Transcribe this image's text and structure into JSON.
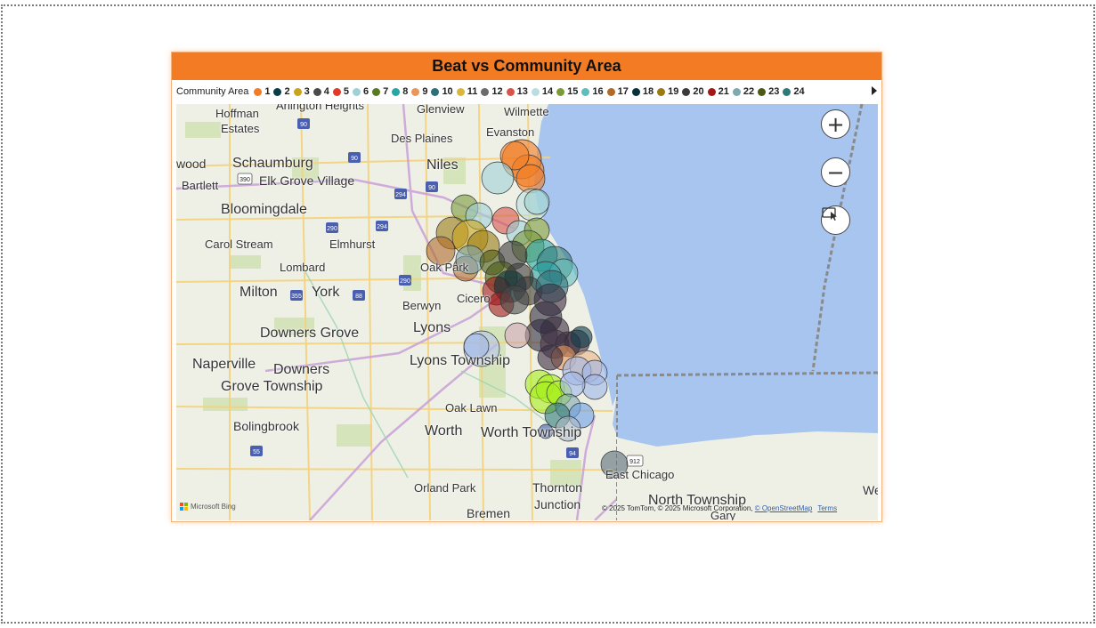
{
  "visual": {
    "title": "Beat vs Community Area"
  },
  "legend": {
    "title": "Community Area",
    "items": [
      {
        "label": "1",
        "color": "#f27b23"
      },
      {
        "label": "2",
        "color": "#0b3c4a"
      },
      {
        "label": "3",
        "color": "#c9a31a"
      },
      {
        "label": "4",
        "color": "#4a4a4a"
      },
      {
        "label": "5",
        "color": "#e03a2a"
      },
      {
        "label": "6",
        "color": "#9fd0d6"
      },
      {
        "label": "7",
        "color": "#5a7a22"
      },
      {
        "label": "8",
        "color": "#2aa5a5"
      },
      {
        "label": "9",
        "color": "#e9965a"
      },
      {
        "label": "10",
        "color": "#2e6e78"
      },
      {
        "label": "11",
        "color": "#d7b83a"
      },
      {
        "label": "12",
        "color": "#6b6b6b"
      },
      {
        "label": "13",
        "color": "#d9534a"
      },
      {
        "label": "14",
        "color": "#b9dde0"
      },
      {
        "label": "15",
        "color": "#7a9a3a"
      },
      {
        "label": "16",
        "color": "#5fbcbc"
      },
      {
        "label": "17",
        "color": "#b06a2a"
      },
      {
        "label": "18",
        "color": "#08323a"
      },
      {
        "label": "19",
        "color": "#9a7a12"
      },
      {
        "label": "20",
        "color": "#3a3a3a"
      },
      {
        "label": "21",
        "color": "#a01818"
      },
      {
        "label": "22",
        "color": "#7fa8b0"
      },
      {
        "label": "23",
        "color": "#4a5a12"
      },
      {
        "label": "24",
        "color": "#2e7a78"
      }
    ]
  },
  "map": {
    "place_labels": [
      "Arlington Heights",
      "Glenview",
      "Wilmette",
      "Hoffman",
      "Estates",
      "Des Plaines",
      "Evanston",
      "wood",
      "Schaumburg",
      "Niles",
      "Bartlett",
      "Elk Grove Village",
      "Bloomingdale",
      "Carol Stream",
      "Elmhurst",
      "Lombard",
      "Oak Park",
      "Milton",
      "York",
      "Berwyn",
      "Cicero",
      "Lyons",
      "Downers Grove",
      "Naperville",
      "Downers",
      "Lyons Township",
      "Grove Township",
      "Oak Lawn",
      "Bolingbrook",
      "Worth",
      "Worth Township",
      "East Chicago",
      "Orland Park",
      "Thornton",
      "Junction",
      "North Township",
      "Bremen",
      "Gary",
      "We"
    ],
    "highway_shields": [
      "90",
      "90",
      "294",
      "390",
      "90",
      "290",
      "294",
      "290",
      "355",
      "88",
      "55",
      "94",
      "912"
    ],
    "controls": {
      "zoom_in": "+",
      "zoom_out": "−"
    },
    "copyright": "© 2025 TomTom, © 2025 Microsoft Corporation, ",
    "osm_link": "© OpenStreetMap",
    "terms_link": "Terms",
    "bing_logo": "Microsoft Bing",
    "water_color": "#a8c5ef",
    "land_color": "#eef0e6"
  }
}
